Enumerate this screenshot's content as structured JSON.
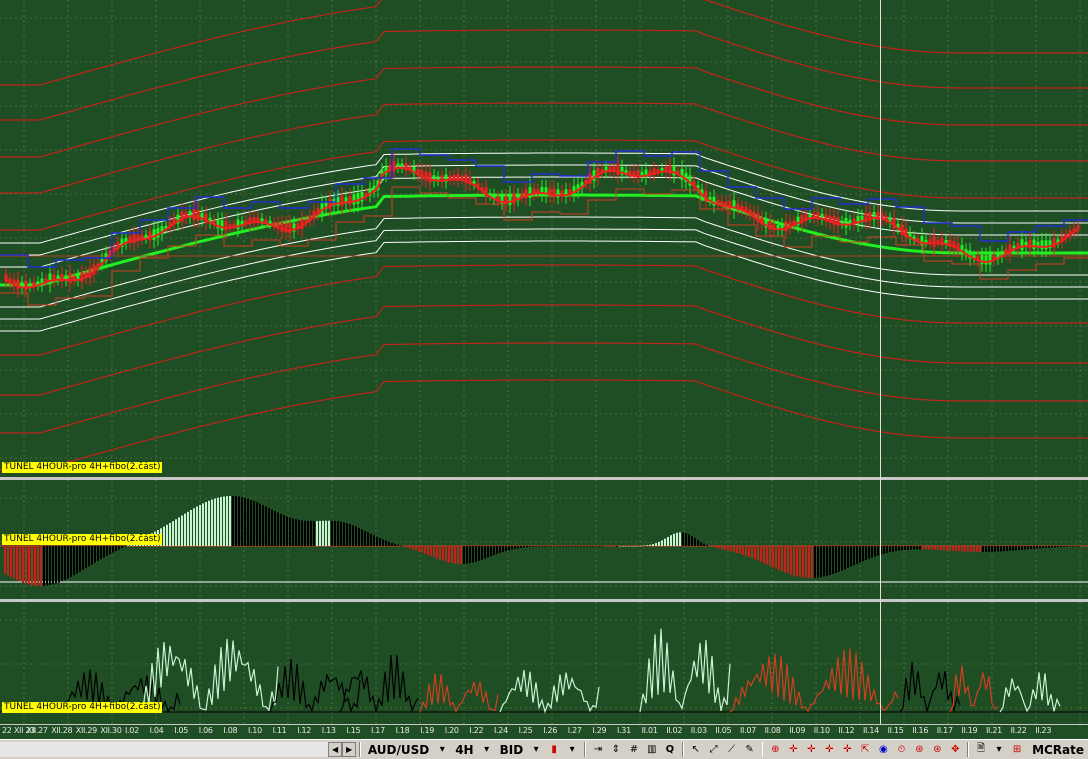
{
  "panes": {
    "main_label": "TUNEL 4HOUR-pro 4H+fibo(2.část)",
    "osc_label": "TUNEL 4HOUR-pro 4H+fibo(2.část)",
    "line_label": "TUNEL 4HOUR-pro 4H+fibo(2.část)"
  },
  "time_axis": [
    "22 XII 23",
    "XII.27",
    "XII.28",
    "XII.29",
    "XII.30",
    "I.02",
    "I.04",
    "I.05",
    "I.06",
    "I.08",
    "I.10",
    "I.11",
    "I.12",
    "I.13",
    "I.15",
    "I.17",
    "I.18",
    "I.19",
    "I.20",
    "I.22",
    "I.24",
    "I.25",
    "I.26",
    "I.27",
    "I.29",
    "I.31",
    "II.01",
    "II.02",
    "II.03",
    "II.05",
    "II.07",
    "II.08",
    "II.09",
    "II.10",
    "II.12",
    "II.14",
    "II.15",
    "II.16",
    "II.17",
    "II.19",
    "II.21",
    "II.22",
    "II.23"
  ],
  "toolbar": {
    "symbol": "AUD/USD",
    "timeframe": "4H",
    "price_type": "BID",
    "rates_label": "MCRate"
  },
  "colors": {
    "background": "#1f4d24",
    "tunnel_red": "#c0241a",
    "tunnel_white": "#ffffff",
    "ma_green": "#22ee22",
    "candle_up": "#22ee22",
    "candle_down": "#ee2020",
    "bar_light": "#c8f5d0",
    "bar_dark": "#000000",
    "bar_red": "#c0241a"
  }
}
